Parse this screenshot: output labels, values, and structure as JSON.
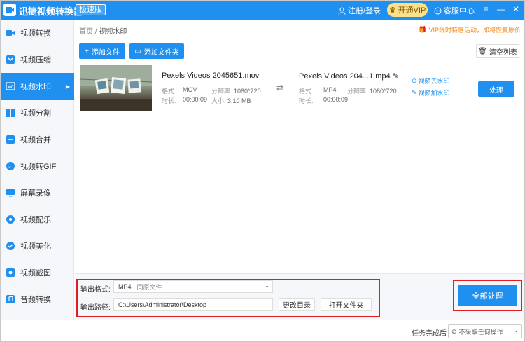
{
  "app": {
    "title": "迅捷视频转换器",
    "edition_badge": "极速版"
  },
  "header": {
    "login_label": "注册/登录",
    "vip_label": "开通VIP",
    "support_label": "客服中心"
  },
  "sidebar": {
    "items": [
      {
        "label": "视频转换",
        "icon": "video-convert-icon"
      },
      {
        "label": "视频压缩",
        "icon": "video-compress-icon"
      },
      {
        "label": "视频水印",
        "icon": "video-watermark-icon",
        "active": true
      },
      {
        "label": "视频分割",
        "icon": "video-split-icon"
      },
      {
        "label": "视频合并",
        "icon": "video-merge-icon"
      },
      {
        "label": "视频转GIF",
        "icon": "video-gif-icon"
      },
      {
        "label": "屏幕录像",
        "icon": "screen-record-icon"
      },
      {
        "label": "视频配乐",
        "icon": "video-music-icon"
      },
      {
        "label": "视频美化",
        "icon": "video-beautify-icon"
      },
      {
        "label": "视频截图",
        "icon": "video-screenshot-icon"
      },
      {
        "label": "音频转换",
        "icon": "audio-convert-icon"
      }
    ]
  },
  "breadcrumb": {
    "home": "首页",
    "separator": "/",
    "current": "视频水印"
  },
  "promo": {
    "text": "VIP限时特惠活动，即将恢复原价"
  },
  "toolbar": {
    "add_file": "添加文件",
    "add_folder": "添加文件夹",
    "clear_list": "清空列表"
  },
  "file": {
    "source": {
      "name": "Pexels Videos 2045651.mov",
      "format_label": "格式:",
      "format": "MOV",
      "resolution_label": "分辨率:",
      "resolution": "1080*720",
      "duration_label": "时长:",
      "duration": "00:00:09",
      "size_label": "大小:",
      "size": "3.10 MB"
    },
    "output": {
      "name": "Pexels Videos 204...1.mp4",
      "format_label": "格式:",
      "format": "MP4",
      "resolution_label": "分辨率:",
      "resolution": "1080*720",
      "duration_label": "时长:",
      "duration": "00:00:09"
    },
    "remove_watermark": "视频去水印",
    "add_watermark": "视频加水印",
    "process_label": "处理"
  },
  "bottom": {
    "format_label": "输出格式:",
    "format_value": "MP4",
    "format_quality": "同原文件",
    "path_label": "输出路径:",
    "path_value": "C:\\Users\\Administrator\\Desktop",
    "change_dir": "更改目录",
    "open_folder": "打开文件夹",
    "process_all": "全部处理"
  },
  "status": {
    "on_complete_label": "任务完成后",
    "on_complete_value": "不采取任何操作"
  },
  "colors": {
    "accent": "#1f8ff0",
    "highlight_box": "#e02020",
    "vip": "#fde08a",
    "promo": "#f08a1c"
  }
}
